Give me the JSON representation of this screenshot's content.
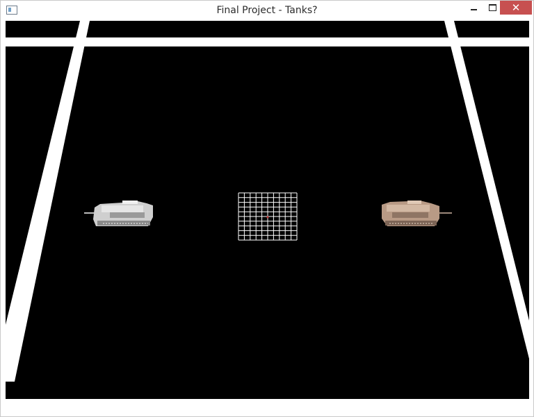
{
  "window": {
    "title": "Final Project - Tanks?",
    "close_glyph": "✕"
  },
  "scene": {
    "background_color": "#000000",
    "line_color": "#ffffff",
    "tank_left_color": "#cfcfcf",
    "tank_right_color": "#b89a85"
  }
}
